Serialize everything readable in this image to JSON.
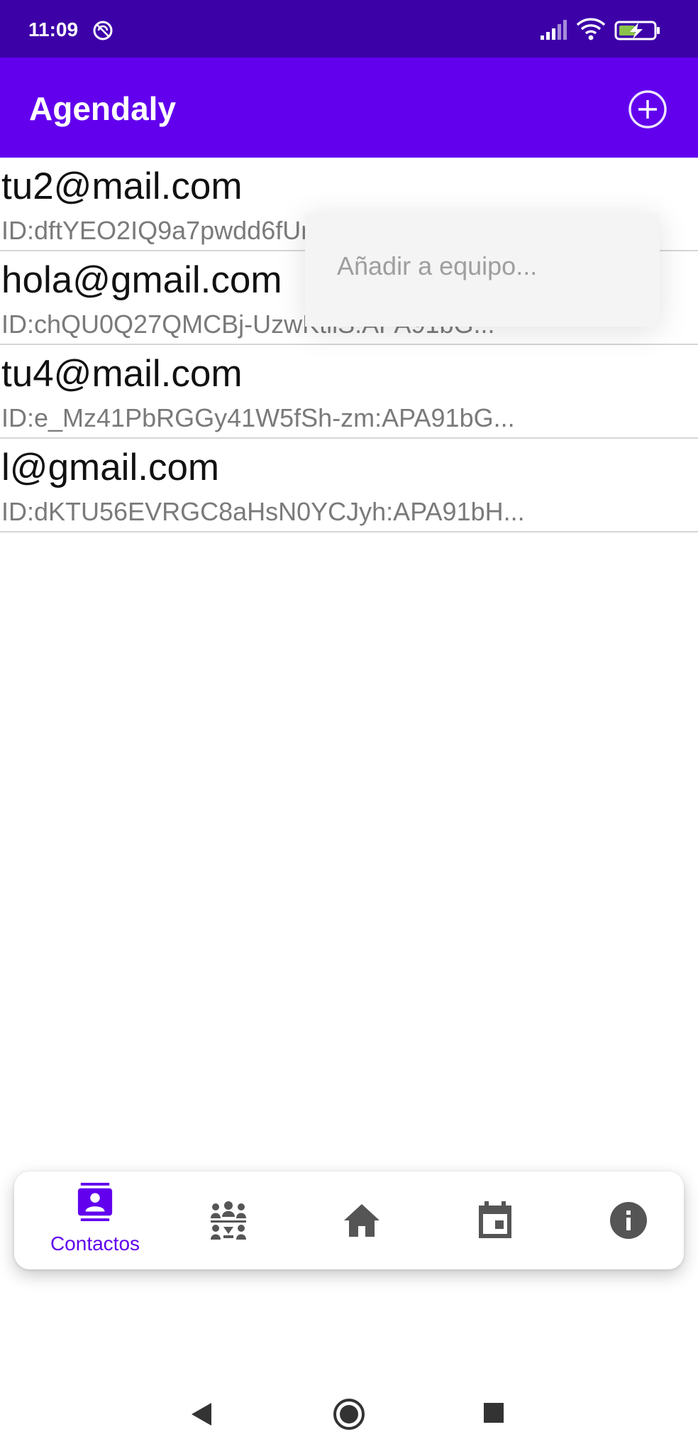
{
  "status_bar": {
    "time": "11:09",
    "icons": [
      "do-not-disturb-icon",
      "signal-icon",
      "wifi-icon",
      "battery-charging-icon"
    ]
  },
  "app_bar": {
    "title": "Agendaly",
    "add_icon": "add-circle-icon"
  },
  "contacts": [
    {
      "email": "tu2@mail.com",
      "id": "ID:dftYEO2IQ9a7pwdd6fUmqf:APA91bH..."
    },
    {
      "email": "hola@gmail.com",
      "id": "ID:chQU0Q27QMCBj-UzwKtilS:APA91bG..."
    },
    {
      "email": "tu4@mail.com",
      "id": "ID:e_Mz41PbRGGy41W5fSh-zm:APA91bG..."
    },
    {
      "email": "l@gmail.com",
      "id": "ID:dKTU56EVRGC8aHsN0YCJyh:APA91bH..."
    }
  ],
  "popup_menu": {
    "items": [
      "Añadir a equipo..."
    ]
  },
  "bottom_nav": {
    "items": [
      {
        "label": "Contactos",
        "icon": "contacts-icon",
        "selected": true
      },
      {
        "label": "",
        "icon": "groups-icon",
        "selected": false
      },
      {
        "label": "",
        "icon": "home-icon",
        "selected": false
      },
      {
        "label": "",
        "icon": "calendar-icon",
        "selected": false
      },
      {
        "label": "",
        "icon": "info-icon",
        "selected": false
      }
    ]
  },
  "colors": {
    "status_bar": "#3d01a8",
    "app_bar": "#6200ee",
    "accent": "#6200ee",
    "icon_inactive": "#555555",
    "divider": "#d6d6d6"
  }
}
